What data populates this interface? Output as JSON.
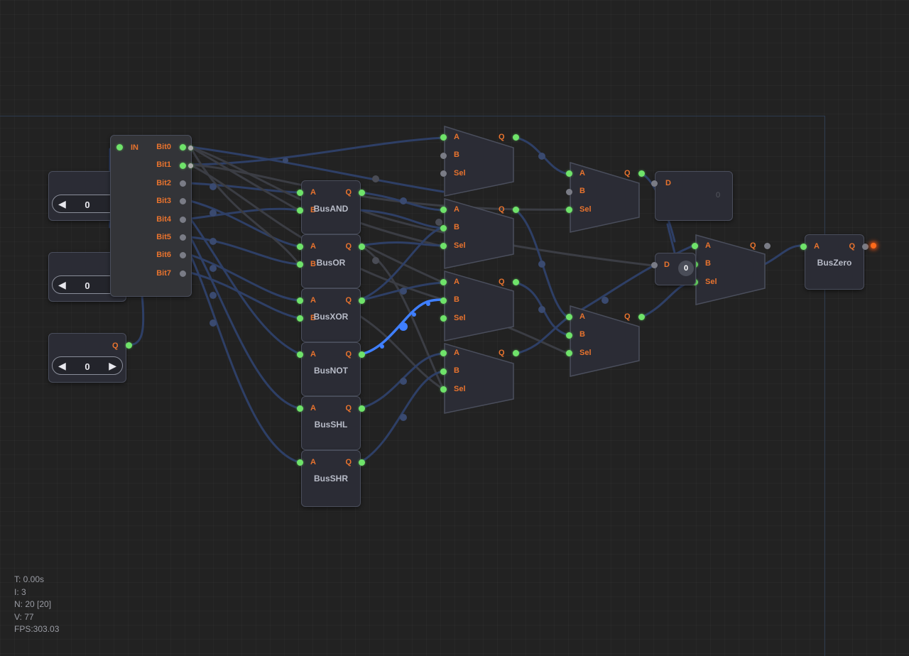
{
  "inputs": [
    {
      "value": "0",
      "left_label": "◀",
      "right_label": "▶"
    },
    {
      "value": "0",
      "left_label": "◀",
      "right_label": "▶"
    },
    {
      "value": "0",
      "left_label": "◀",
      "right_label": "▶",
      "out_label": "Q"
    }
  ],
  "splitter": {
    "in_label": "IN",
    "bits": [
      "Bit0",
      "Bit1",
      "Bit2",
      "Bit3",
      "Bit4",
      "Bit5",
      "Bit6",
      "Bit7"
    ]
  },
  "ops": [
    {
      "name": "BusAND",
      "a": "A",
      "b": "B",
      "q": "Q"
    },
    {
      "name": "BusOR",
      "a": "A",
      "b": "B",
      "q": "Q"
    },
    {
      "name": "BusXOR",
      "a": "A",
      "b": "B",
      "q": "Q"
    },
    {
      "name": "BusNOT",
      "a": "A",
      "q": "Q"
    },
    {
      "name": "BusSHL",
      "a": "A",
      "q": "Q"
    },
    {
      "name": "BusSHR",
      "a": "A",
      "q": "Q"
    }
  ],
  "mux_labels": {
    "a": "A",
    "b": "B",
    "sel": "Sel",
    "q": "Q"
  },
  "dlatch": {
    "label": "D",
    "value_top": "0",
    "value_bottom": "0"
  },
  "buszero": {
    "name": "BusZero",
    "a": "A",
    "q": "Q"
  },
  "stats": [
    "T: 0.00s",
    "I: 3",
    "N: 20 [20]",
    "V: 77",
    "FPS:303.03"
  ],
  "colors": {
    "wire": "#2e3f66",
    "wire_mixed": "#3b3d44",
    "active_wire": "#3f7fff",
    "pin_on": "#6fe36a",
    "pin_off": "#7a7c86",
    "label": "#e8732e"
  }
}
